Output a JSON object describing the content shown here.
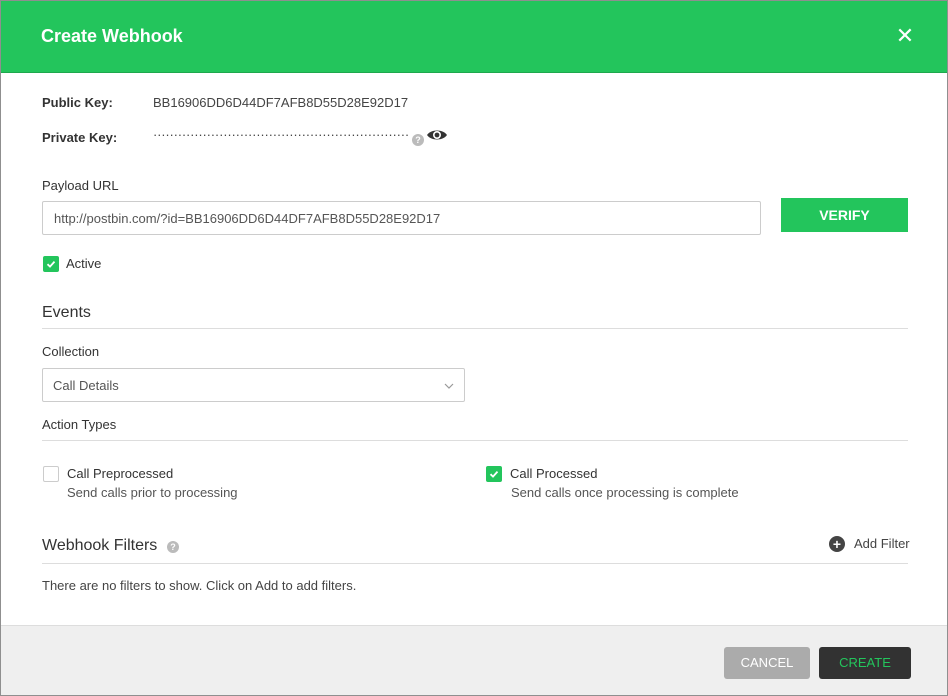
{
  "header": {
    "title": "Create Webhook",
    "close_icon": "close-icon"
  },
  "keys": {
    "public_label": "Public Key:",
    "public_value": "BB16906DD6D44DF7AFB8D55D28E92D17",
    "private_label": "Private Key:",
    "private_masked": "······························································",
    "help_glyph": "?",
    "reveal_icon": "eye-icon"
  },
  "payload": {
    "label": "Payload URL",
    "value": "http://postbin.com/?id=BB16906DD6D44DF7AFB8D55D28E92D17",
    "verify_label": "VERIFY"
  },
  "active": {
    "label": "Active",
    "checked": true
  },
  "events": {
    "title": "Events",
    "collection_label": "Collection",
    "collection_value": "Call Details",
    "action_types_label": "Action Types",
    "actions": [
      {
        "label": "Call Preprocessed",
        "description": "Send calls prior to processing",
        "checked": false
      },
      {
        "label": "Call Processed",
        "description": "Send calls once processing is complete",
        "checked": true
      }
    ]
  },
  "filters": {
    "title": "Webhook Filters",
    "add_label": "Add Filter",
    "add_glyph": "+",
    "empty_text": "There are no filters to show. Click on Add to add filters."
  },
  "footer": {
    "cancel_label": "CANCEL",
    "create_label": "CREATE"
  },
  "colors": {
    "accent": "#23c55c",
    "dark": "#323232",
    "muted_button": "#ababab"
  }
}
